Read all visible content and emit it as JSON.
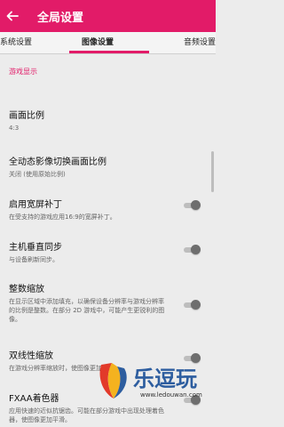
{
  "appbar": {
    "title": "全局设置",
    "back_icon": "arrow-left-icon",
    "background": "#e21b68"
  },
  "tabs": [
    {
      "label": "系统设置"
    },
    {
      "label": "图像设置",
      "selected": true
    },
    {
      "label": "音频设置"
    }
  ],
  "section": {
    "header": "游戏显示"
  },
  "items": [
    {
      "title": "画面比例",
      "summary": "4:3"
    },
    {
      "title": "全动态影像切换画面比例",
      "summary": "关闭 (使用原始比例)"
    },
    {
      "title": "启用宽屏补丁",
      "summary": "在受支持的游戏应用16:9的宽屏补丁。",
      "toggle": false
    },
    {
      "title": "主机垂直同步",
      "summary": "与设备刷新同步。",
      "toggle": false
    },
    {
      "title": "整数缩放",
      "summary": "在显示区域中添加填充，以确保设备分辨率与游戏分辨率的比例是整数。在部分 2D 游戏中，可能产生更锐利的图像。",
      "toggle": false
    },
    {
      "title": "双线性缩放",
      "summary": "在游戏分辨率缩放时，使图像更加平滑。",
      "toggle": false
    },
    {
      "title": "FXAA着色器",
      "summary": "应用快速的近似抗锯齿。可能在部分游戏中出现处理着色器，使图像更加平滑。",
      "toggle": false
    }
  ],
  "watermark": {
    "text": "乐逗玩",
    "url": "www.ledouwan.com"
  }
}
